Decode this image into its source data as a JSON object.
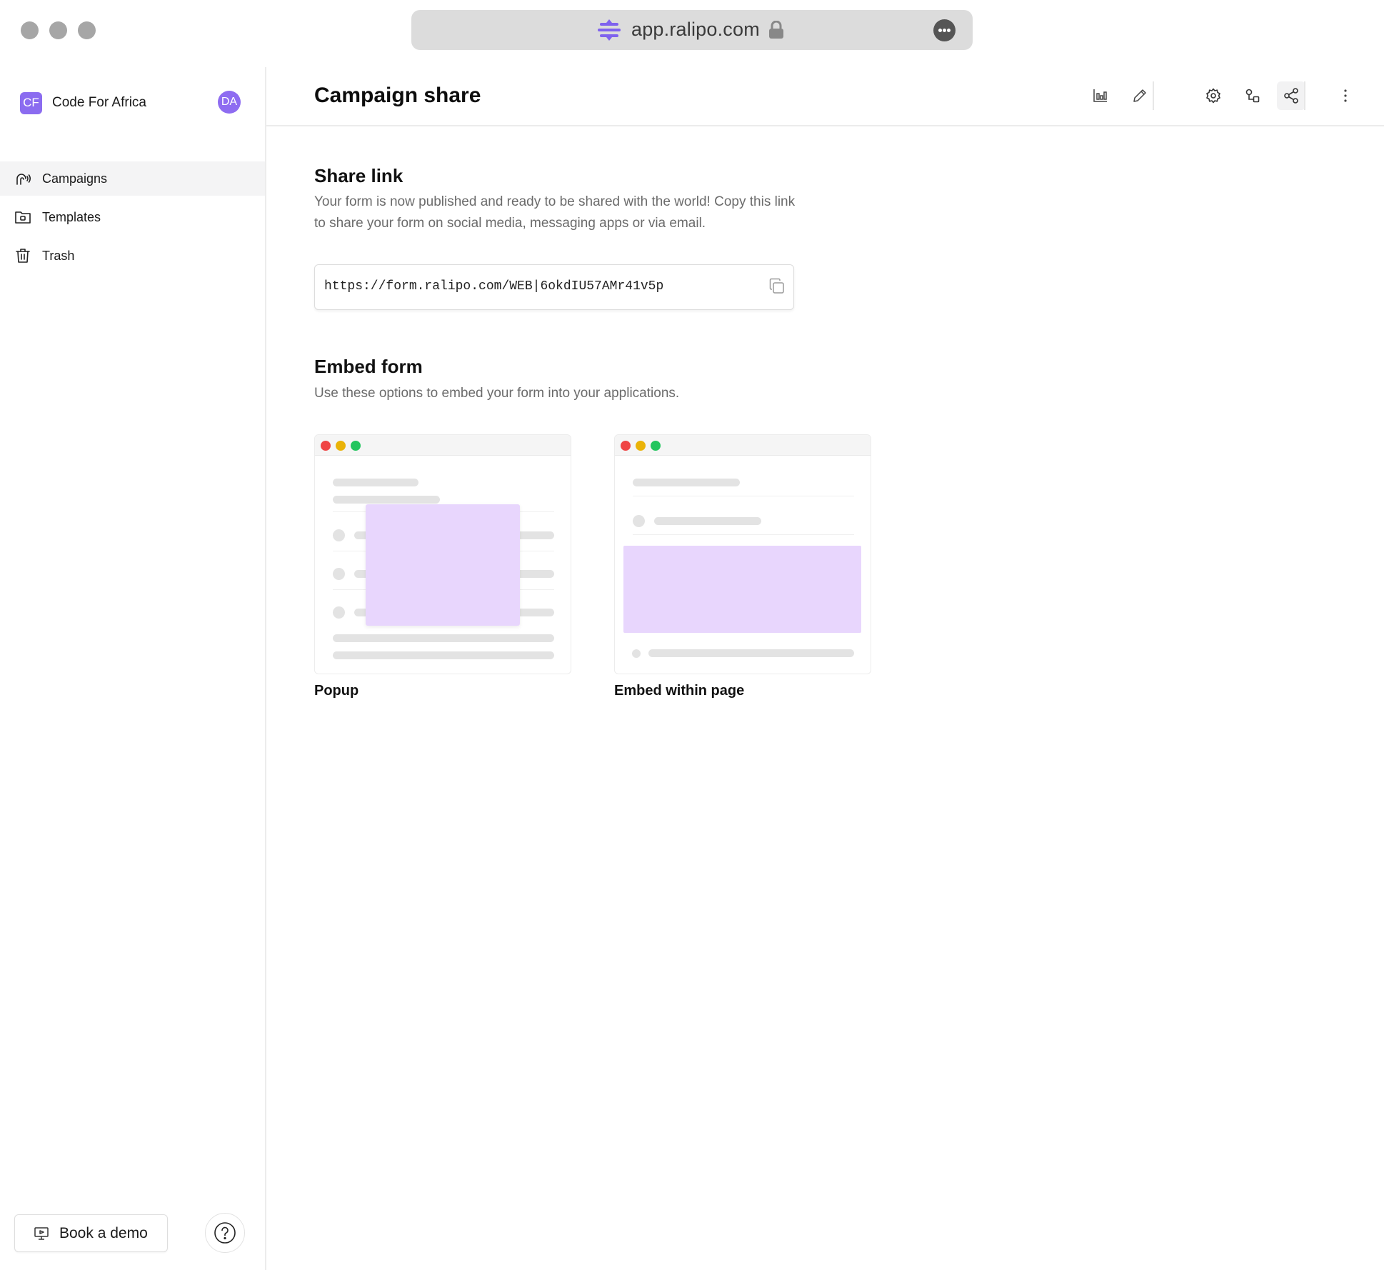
{
  "browser": {
    "url": "app.ralipo.com"
  },
  "sidebar": {
    "org_badge": "CF",
    "org_name": "Code For Africa",
    "user_initials": "DA",
    "items": [
      {
        "label": "Campaigns",
        "icon": "campaigns-icon",
        "active": true
      },
      {
        "label": "Templates",
        "icon": "templates-folder-icon",
        "active": false
      },
      {
        "label": "Trash",
        "icon": "trash-icon",
        "active": false
      }
    ],
    "book_demo_label": "Book a demo"
  },
  "header": {
    "title": "Campaign share",
    "tools": [
      "analytics-icon",
      "edit-icon",
      "settings-icon",
      "integrations-icon",
      "share-icon",
      "more-vertical-icon"
    ]
  },
  "share": {
    "title": "Share link",
    "description": "Your form is now published and ready to be shared with the world! Copy this link to share your form on social media, messaging apps or via email.",
    "link": "https://form.ralipo.com/WEB|6okdIU57AMr41v5p"
  },
  "embed": {
    "title": "Embed form",
    "description": "Use these options to embed your form into your applications.",
    "options": [
      {
        "label": "Popup"
      },
      {
        "label": "Embed within page"
      }
    ]
  },
  "colors": {
    "accent": "#8b6cf0",
    "preview_highlight": "#e8d6fd",
    "traffic_red": "#ef4444",
    "traffic_yellow": "#eab308",
    "traffic_green": "#22c55e"
  }
}
